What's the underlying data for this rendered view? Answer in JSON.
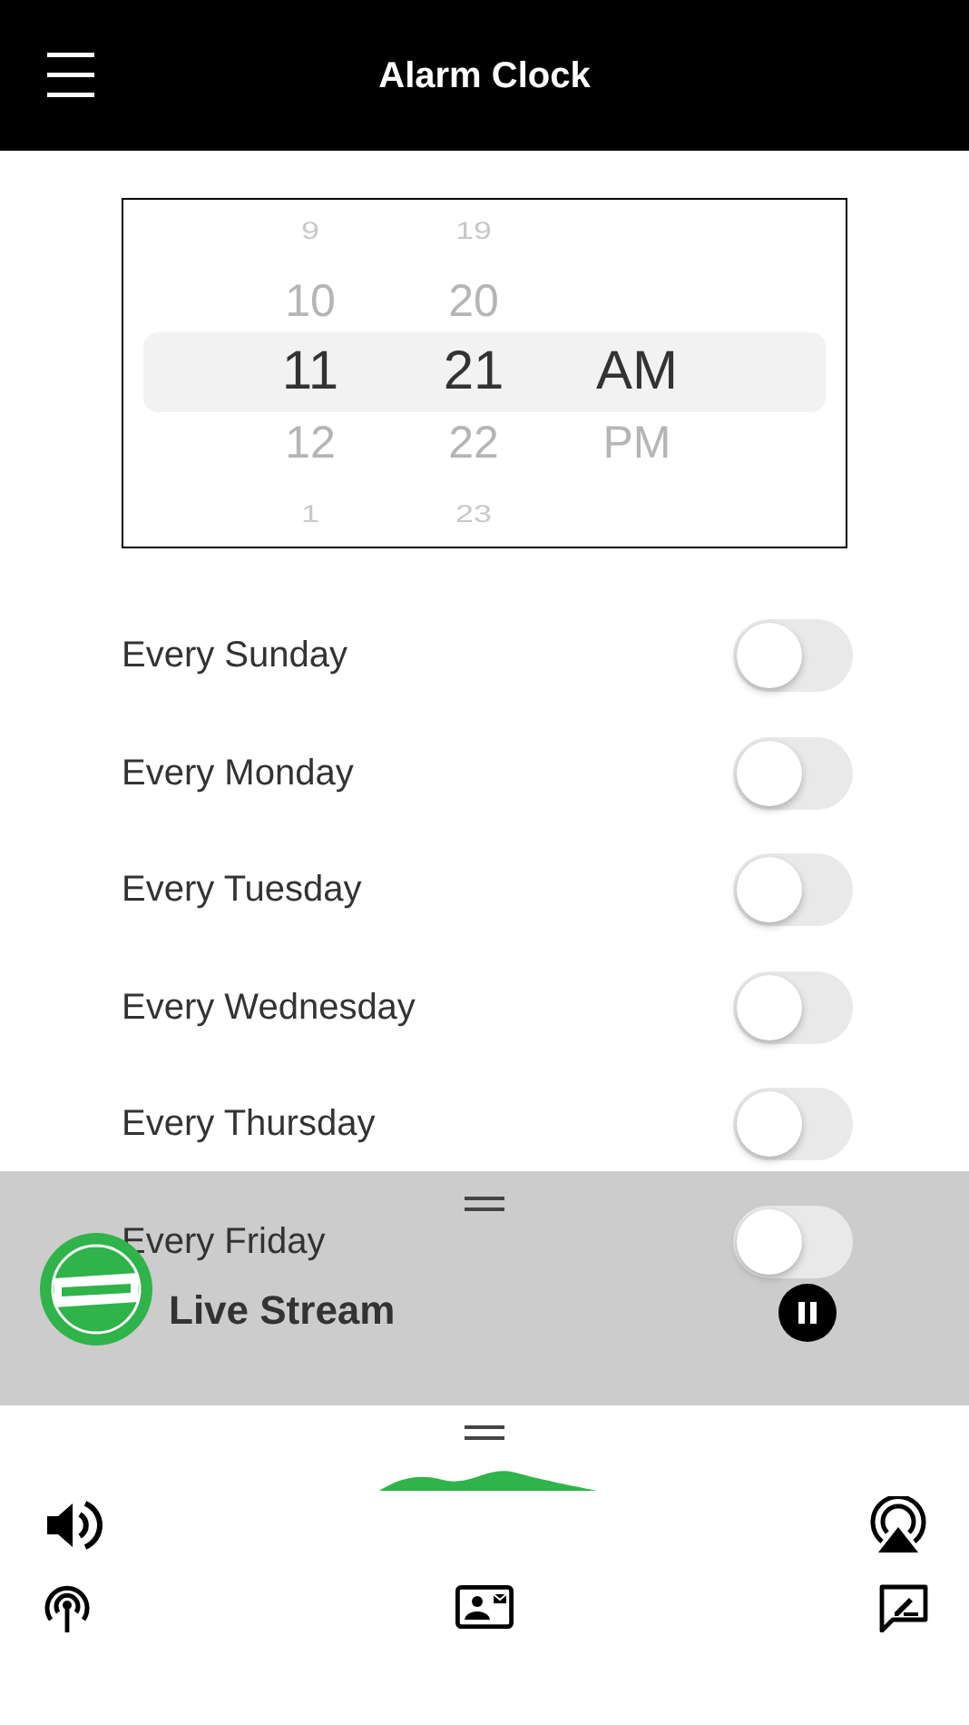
{
  "header": {
    "title": "Alarm Clock"
  },
  "picker": {
    "columns": [
      {
        "items": [
          {
            "label": "9",
            "selected": false
          },
          {
            "label": "10",
            "selected": false
          },
          {
            "label": "11",
            "selected": true
          },
          {
            "label": "12",
            "selected": false
          },
          {
            "label": "1",
            "selected": false
          }
        ]
      },
      {
        "items": [
          {
            "label": "19",
            "selected": false
          },
          {
            "label": "20",
            "selected": false
          },
          {
            "label": "21",
            "selected": true
          },
          {
            "label": "22",
            "selected": false
          },
          {
            "label": "23",
            "selected": false
          }
        ]
      },
      {
        "items": [
          {
            "label": "AM",
            "selected": true
          },
          {
            "label": "PM",
            "selected": false
          }
        ]
      }
    ]
  },
  "days": [
    {
      "label": "Every Sunday",
      "on": false
    },
    {
      "label": "Every Monday",
      "on": false
    },
    {
      "label": "Every Tuesday",
      "on": false
    },
    {
      "label": "Every Wednesday",
      "on": false
    },
    {
      "label": "Every Thursday",
      "on": false
    },
    {
      "label": "Every Friday",
      "on": false
    }
  ],
  "player": {
    "title": "Live Stream",
    "playing": true
  }
}
